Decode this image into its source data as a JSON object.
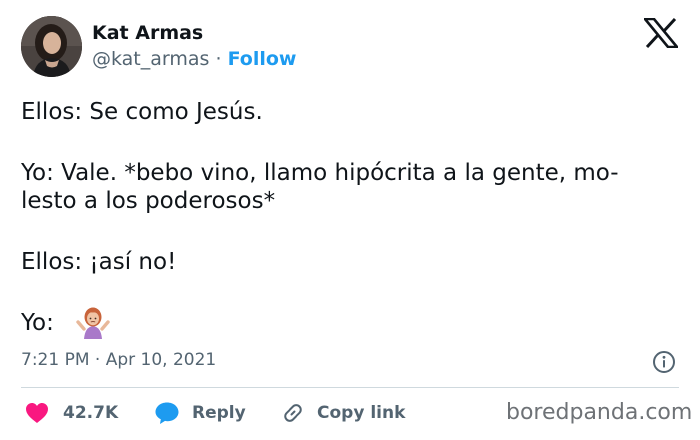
{
  "author": {
    "display_name": "Kat Armas",
    "handle": "@kat_armas",
    "separator": " · ",
    "follow_label": "Follow"
  },
  "tweet": {
    "lines": [
      "Ellos: Se como Jesús.",
      "Yo: Vale. *bebo vino, llamo hipócrita a la gente, mo-",
      "lesto a los poderosos*",
      "Ellos: ¡así no!",
      "Yo:"
    ],
    "emoji": "woman-shrugging-emoji",
    "timestamp": "7:21 PM · Apr 10, 2021"
  },
  "actions": {
    "like_count": "42.7K",
    "reply_label": "Reply",
    "copy_link_label": "Copy link"
  },
  "watermark": "boredpanda.com",
  "icons": {
    "like": "heart-icon",
    "reply": "speech-bubble-icon",
    "copy_link": "link-icon",
    "info": "info-icon",
    "logo": "x-logo-icon"
  },
  "colors": {
    "text": "#0f1419",
    "secondary": "#536471",
    "follow": "#1d9bf0",
    "like": "#f91880",
    "reply": "#1d9bf0",
    "divider": "#cfd9de"
  }
}
